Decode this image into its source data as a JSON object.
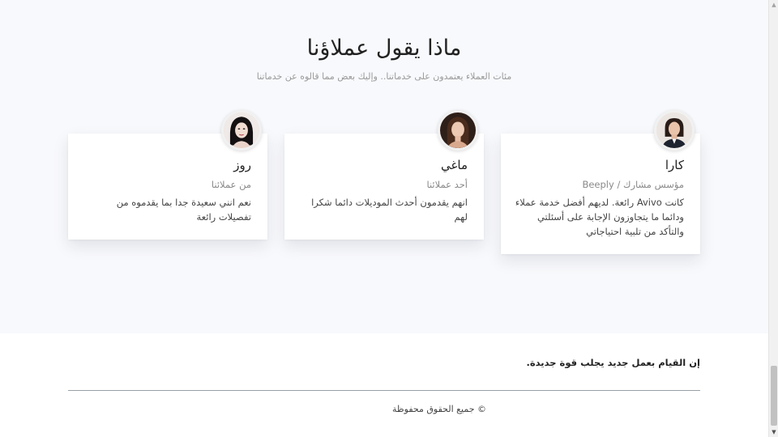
{
  "testimonials": {
    "title": "ماذا يقول عملاؤنا",
    "subtitle": "مئات العملاء يعتمدون على خدماتنا.. وإليك بعض مما قالوه عن خدماتنا",
    "cards": [
      {
        "name": "كارا",
        "role": "مؤسس مشارك / Beeply",
        "text": "كانت Avivo رائعة. لديهم أفضل خدمة عملاء ودائما ما يتجاوزون الإجابة على أسئلتي والتأكد من تلبية احتياجاتي",
        "avatar_icon": "woman-portrait-icon"
      },
      {
        "name": "ماغي",
        "role": "أحد عملائنا",
        "text": "انهم يقدمون أحدث الموديلات دائما شكرا لهم",
        "avatar_icon": "woman-portrait-icon"
      },
      {
        "name": "روز",
        "role": "من عملائنا",
        "text": "نعم انني سعيدة جدا بما يقدموه من تفصيلات رائعة",
        "avatar_icon": "woman-portrait-icon"
      }
    ]
  },
  "footer": {
    "tagline": "إن القيام بعمل جديد يجلب قوة جديدة.",
    "copyright": "© جميع الحقوق محفوظة"
  },
  "colors": {
    "section_bg": "#f8f9fc",
    "card_bg": "#ffffff",
    "divider": "#9aa0a6"
  }
}
